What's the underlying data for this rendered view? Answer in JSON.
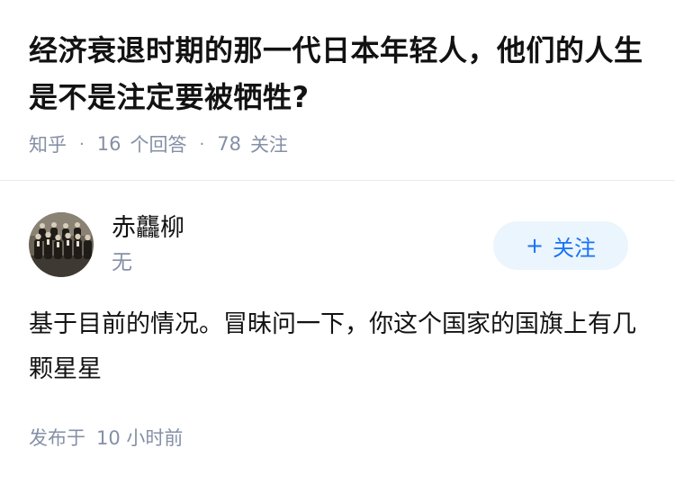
{
  "question": {
    "title": "经济衰退时期的那一代日本年轻人，他们的人生是不是注定要被牺牲?",
    "source": "知乎",
    "answer_count": "16",
    "answer_label": "个回答",
    "follow_count": "78",
    "follow_label": "关注",
    "separator": "·"
  },
  "answer": {
    "author_name": "赤龘柳",
    "author_headline": "无",
    "avatar_icon": "group-photo-avatar-icon",
    "follow_button": {
      "icon": "plus-icon",
      "icon_glyph": "+",
      "label": "关注"
    },
    "content": "基于目前的情况。冒昧问一下，你这个国家的国旗上有几颗星星",
    "time_prefix": "发布于",
    "time_value": "10 小时前"
  },
  "colors": {
    "title_text": "#121212",
    "meta_text": "#8590a6",
    "accent_blue": "#1772f6",
    "follow_button_bg": "#ebf5fd",
    "divider": "#ebebeb"
  }
}
